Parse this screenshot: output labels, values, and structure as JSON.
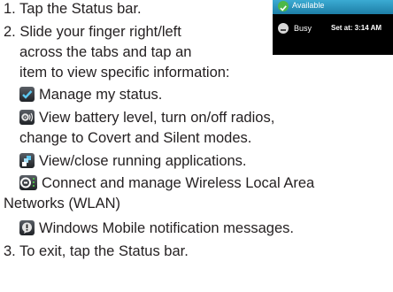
{
  "steps": {
    "step1": "1. Tap the Status bar.",
    "step2_l1": "2. Slide your finger right/left",
    "step2_l2": "across the tabs and tap an",
    "step2_l3": "item to view specific information:",
    "step3": "3. To exit, tap the Status bar."
  },
  "items": [
    {
      "icon": "check-icon",
      "text": "Manage my status."
    },
    {
      "icon": "gear-radio-icon",
      "text_l1": "View battery level, turn on/off radios,",
      "text_l2": "change to Covert and Silent modes."
    },
    {
      "icon": "apps-icon",
      "text": "View/close running applications."
    },
    {
      "icon": "wlan-icon",
      "text_l1": "Connect and manage Wireless Local Area",
      "text_l2": "Networks (WLAN)"
    },
    {
      "icon": "notification-icon",
      "text": "Windows Mobile notification messages."
    }
  ],
  "panel": {
    "available_label": "Available",
    "busy_label": "Busy",
    "set_at_label": "Set at: 3:14 AM"
  },
  "colors": {
    "text": "#231f20",
    "panel_bg": "#000000",
    "available_green": "#4db848"
  }
}
